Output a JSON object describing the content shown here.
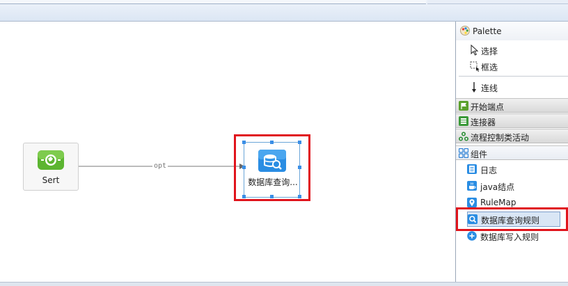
{
  "canvas": {
    "start_node": {
      "label": "Sert"
    },
    "edge": {
      "label": "opt"
    },
    "db_node": {
      "label": "数据库查询..."
    }
  },
  "palette": {
    "title": "Palette",
    "tools": [
      {
        "label": "选择",
        "icon": "pointer-icon"
      },
      {
        "label": "框选",
        "icon": "marquee-icon"
      },
      {
        "label": "连线",
        "icon": "connection-arrow-icon"
      }
    ],
    "drawers": [
      {
        "label": "开始端点",
        "icon": "flag-icon",
        "color": "#5aa02c"
      },
      {
        "label": "连接器",
        "icon": "connector-icon",
        "color": "#3b9a3a"
      },
      {
        "label": "流程控制类活动",
        "icon": "flow-control-icon",
        "color": "#2f8f3a"
      },
      {
        "label": "组件",
        "icon": "components-icon",
        "color": "#2a7fd4"
      }
    ],
    "entries": [
      {
        "label": "日志",
        "icon": "log-icon"
      },
      {
        "label": "java结点",
        "icon": "java-icon"
      },
      {
        "label": "RuleMap",
        "icon": "map-pin-icon"
      },
      {
        "label": "数据库查询规则",
        "icon": "db-query-icon"
      },
      {
        "label": "数据库写入规则",
        "icon": "db-write-icon"
      }
    ]
  },
  "colors": {
    "highlight": "#e0141c",
    "accent": "#2a8de3",
    "start_green": "#5cb531"
  }
}
